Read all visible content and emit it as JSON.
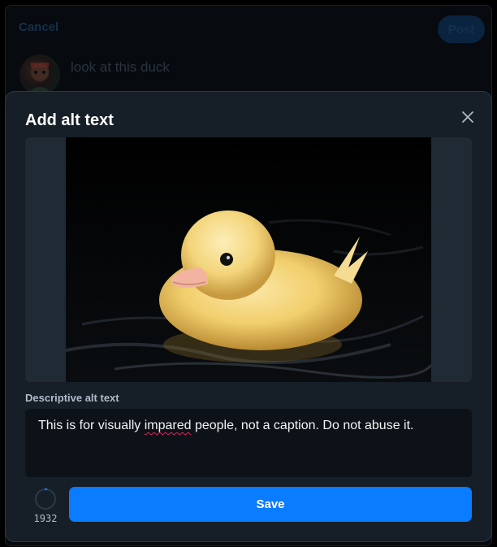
{
  "composer": {
    "cancel_label": "Cancel",
    "post_label": "Post",
    "draft_text": "look at this duck"
  },
  "modal": {
    "title": "Add alt text",
    "close_icon": "close-icon",
    "image_subject": "duckling swimming on dark water",
    "field_label": "Descriptive alt text",
    "alt_text": {
      "before": "This is for visually ",
      "misspelled": "impared",
      "after": " people, not a caption. Do not abuse it."
    },
    "char_count": "1932",
    "save_label": "Save"
  },
  "colors": {
    "accent": "#0a7cff",
    "modal_bg": "#161e27",
    "textarea_bg": "#0d1218"
  }
}
